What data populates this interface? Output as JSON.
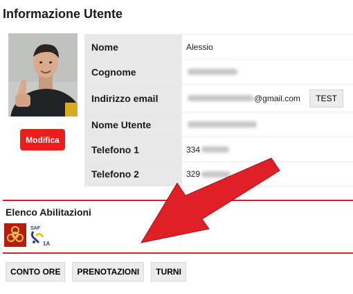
{
  "page": {
    "title": "Informazione Utente"
  },
  "profile": {
    "edit_label": "Modifica"
  },
  "info": {
    "rows": [
      {
        "label": "Nome",
        "value": "Alessio"
      },
      {
        "label": "Cognome",
        "value": ""
      },
      {
        "label": "Indirizzo email",
        "value": "@gmail.com",
        "action": "TEST"
      },
      {
        "label": "Nome Utente",
        "value": ""
      },
      {
        "label": "Telefono 1",
        "value": "334"
      },
      {
        "label": "Telefono 2",
        "value": "329"
      }
    ]
  },
  "abilitazioni": {
    "title": "Elenco Abilitazioni",
    "badges": [
      {
        "icon": "biohazard-icon",
        "text": ""
      },
      {
        "icon": "saf-icon",
        "text": "SAF",
        "level": "1A"
      }
    ]
  },
  "actions": {
    "buttons": [
      "CONTO ORE",
      "PRENOTAZIONI",
      "TURNI"
    ]
  },
  "colors": {
    "accent": "#ee1c1c",
    "divider": "#d42020",
    "label_bg": "#e8e8e8"
  }
}
